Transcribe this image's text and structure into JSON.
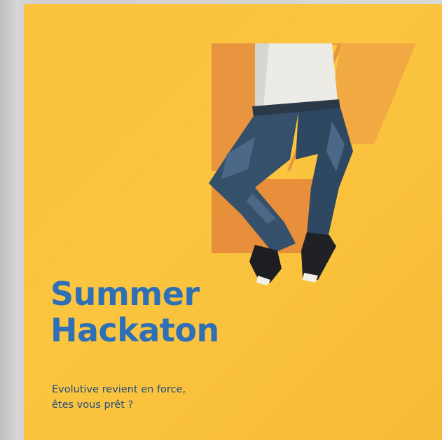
{
  "poster": {
    "title_line1": "Summer",
    "title_line2": "Hackaton",
    "subtitle_line1": "Evolutive revient en force,",
    "subtitle_line2": "êtes vous prêt ?"
  },
  "colors": {
    "background": "#fcc33c",
    "title": "#2e6fb6",
    "subtitle": "#234e80",
    "shape": "#e48a3a"
  }
}
